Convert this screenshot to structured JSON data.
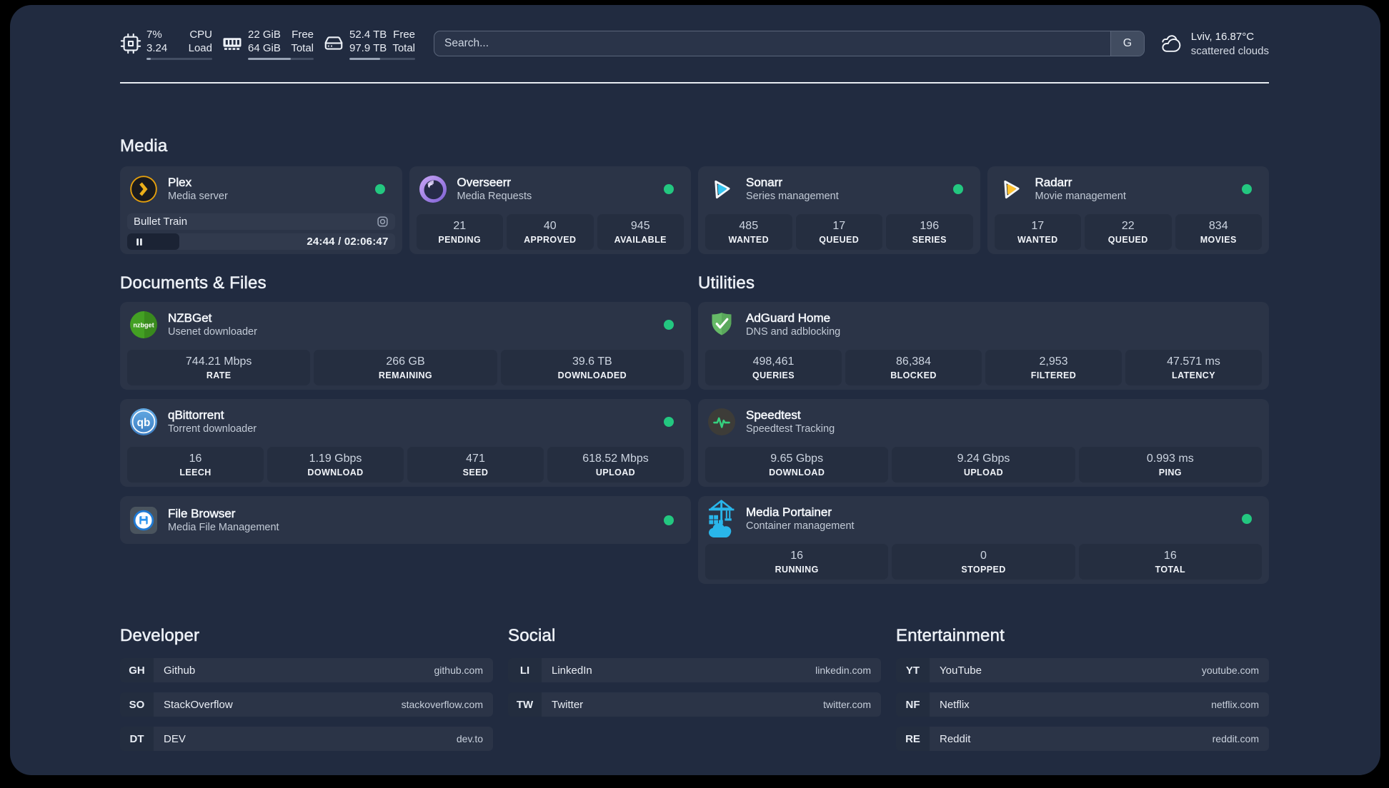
{
  "colors": {
    "status_online": "#23c780",
    "plex_gold": "#e5a00d",
    "sonarr_blue": "#35c5f1",
    "radarr_yellow": "#ffc230",
    "nzbget_green": "#43a023",
    "qbittorrent_blue": "#4a90d9",
    "adguard_green": "#63b663",
    "speedtest_green": "#35d07f",
    "portainer_blue": "#29b6ea"
  },
  "header": {
    "resources": [
      {
        "icon": "cpu-icon",
        "value_top": "7%",
        "value_bottom": "3.24",
        "label_top": "CPU",
        "label_bottom": "Load",
        "percent": 7
      },
      {
        "icon": "memory-icon",
        "value_top": "22 GiB",
        "value_bottom": "64 GiB",
        "label_top": "Free",
        "label_bottom": "Total",
        "percent": 65.6
      },
      {
        "icon": "disk-icon",
        "value_top": "52.4 TB",
        "value_bottom": "97.9 TB",
        "label_top": "Free",
        "label_bottom": "Total",
        "percent": 46.5
      }
    ],
    "search": {
      "placeholder": "Search...",
      "provider_button": "G"
    },
    "weather": {
      "location_temp": "Lviv, 16.87°C",
      "condition": "scattered clouds"
    }
  },
  "groups": {
    "media": {
      "title": "Media",
      "services": [
        {
          "name": "Plex",
          "description": "Media server",
          "icon": "plex-icon",
          "online": true,
          "player": {
            "title": "Bullet Train",
            "elapsed": "24:44",
            "separator": "/",
            "duration": "02:06:47",
            "progress_percent": 19.5
          }
        },
        {
          "name": "Overseerr",
          "description": "Media Requests",
          "icon": "overseerr-icon",
          "online": true,
          "stats": [
            {
              "value": "21",
              "label": "PENDING"
            },
            {
              "value": "40",
              "label": "APPROVED"
            },
            {
              "value": "945",
              "label": "AVAILABLE"
            }
          ]
        },
        {
          "name": "Sonarr",
          "description": "Series management",
          "icon": "sonarr-icon",
          "online": true,
          "stats": [
            {
              "value": "485",
              "label": "WANTED"
            },
            {
              "value": "17",
              "label": "QUEUED"
            },
            {
              "value": "196",
              "label": "SERIES"
            }
          ]
        },
        {
          "name": "Radarr",
          "description": "Movie management",
          "icon": "radarr-icon",
          "online": true,
          "stats": [
            {
              "value": "17",
              "label": "WANTED"
            },
            {
              "value": "22",
              "label": "QUEUED"
            },
            {
              "value": "834",
              "label": "MOVIES"
            }
          ]
        }
      ]
    },
    "documents": {
      "title": "Documents & Files",
      "services": [
        {
          "name": "NZBGet",
          "description": "Usenet downloader",
          "icon": "nzbget-icon",
          "online": true,
          "stats": [
            {
              "value": "744.21 Mbps",
              "label": "RATE"
            },
            {
              "value": "266 GB",
              "label": "REMAINING"
            },
            {
              "value": "39.6 TB",
              "label": "DOWNLOADED"
            }
          ]
        },
        {
          "name": "qBittorrent",
          "description": "Torrent downloader",
          "icon": "qbittorrent-icon",
          "online": true,
          "stats": [
            {
              "value": "16",
              "label": "LEECH"
            },
            {
              "value": "1.19 Gbps",
              "label": "DOWNLOAD"
            },
            {
              "value": "471",
              "label": "SEED"
            },
            {
              "value": "618.52 Mbps",
              "label": "UPLOAD"
            }
          ]
        },
        {
          "name": "File Browser",
          "description": "Media File Management",
          "icon": "filebrowser-icon",
          "online": true,
          "stats": []
        }
      ]
    },
    "utilities": {
      "title": "Utilities",
      "services": [
        {
          "name": "AdGuard Home",
          "description": "DNS and adblocking",
          "icon": "adguard-icon",
          "online": false,
          "stats": [
            {
              "value": "498,461",
              "label": "QUERIES"
            },
            {
              "value": "86,384",
              "label": "BLOCKED"
            },
            {
              "value": "2,953",
              "label": "FILTERED"
            },
            {
              "value": "47.571 ms",
              "label": "LATENCY"
            }
          ]
        },
        {
          "name": "Speedtest",
          "description": "Speedtest Tracking",
          "icon": "speedtest-icon",
          "online": false,
          "stats": [
            {
              "value": "9.65 Gbps",
              "label": "DOWNLOAD"
            },
            {
              "value": "9.24 Gbps",
              "label": "UPLOAD"
            },
            {
              "value": "0.993 ms",
              "label": "PING"
            }
          ]
        },
        {
          "name": "Media Portainer",
          "description": "Container management",
          "icon": "portainer-icon",
          "online": true,
          "stats": [
            {
              "value": "16",
              "label": "RUNNING"
            },
            {
              "value": "0",
              "label": "STOPPED"
            },
            {
              "value": "16",
              "label": "TOTAL"
            }
          ]
        }
      ]
    },
    "bookmarks": [
      {
        "title": "Developer",
        "links": [
          {
            "abbr": "GH",
            "name": "Github",
            "domain": "github.com"
          },
          {
            "abbr": "SO",
            "name": "StackOverflow",
            "domain": "stackoverflow.com"
          },
          {
            "abbr": "DT",
            "name": "DEV",
            "domain": "dev.to"
          }
        ]
      },
      {
        "title": "Social",
        "links": [
          {
            "abbr": "LI",
            "name": "LinkedIn",
            "domain": "linkedin.com"
          },
          {
            "abbr": "TW",
            "name": "Twitter",
            "domain": "twitter.com"
          }
        ]
      },
      {
        "title": "Entertainment",
        "links": [
          {
            "abbr": "YT",
            "name": "YouTube",
            "domain": "youtube.com"
          },
          {
            "abbr": "NF",
            "name": "Netflix",
            "domain": "netflix.com"
          },
          {
            "abbr": "RE",
            "name": "Reddit",
            "domain": "reddit.com"
          }
        ]
      }
    ]
  }
}
